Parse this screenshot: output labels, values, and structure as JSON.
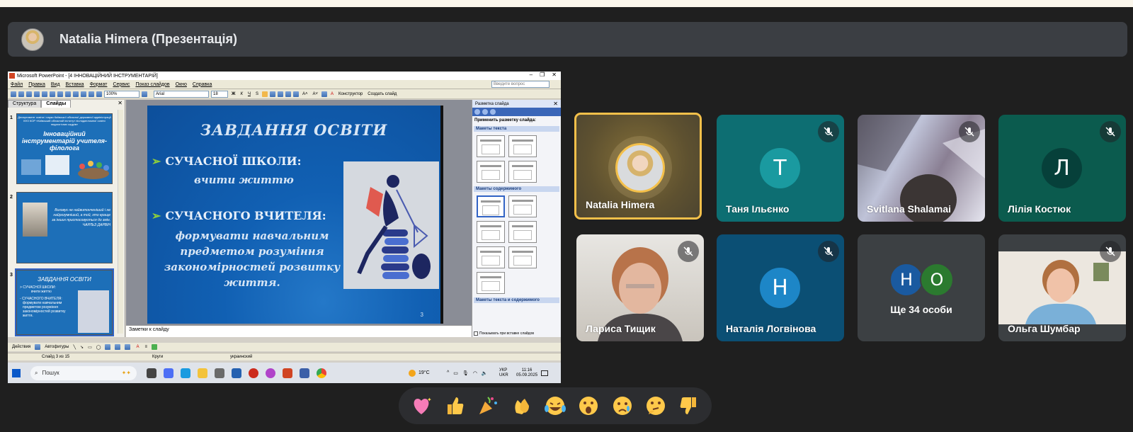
{
  "presenter": {
    "name": "Natalia Himera (Презентація)"
  },
  "ppt": {
    "window_title": "Microsoft PowerPoint - [4 ІННОВАЦІЙНИЙ ІНСТРУМЕНТАРІЙ]",
    "menu": [
      "Файл",
      "Правка",
      "Вид",
      "Вставка",
      "Формат",
      "Сервис",
      "Показ слайдов",
      "Окно",
      "Справка"
    ],
    "ask_placeholder": "Введите вопрос",
    "zoom": "100%",
    "font": "Arial",
    "font_size": "18",
    "designer_button": "Конструктор",
    "new_slide_button": "Создать слайд",
    "pane_tabs": [
      "Структура",
      "Слайды"
    ],
    "thumbnails": [
      {
        "num": "1",
        "head": "Департамент освіти і науки Київської обласної державної адміністрації КНЗ КОР «Київський обласний інститут післядипломної освіти педагогічних кадрів»",
        "title": "Інноваційний інструментарій учителя-філолога"
      },
      {
        "num": "2",
        "quote": "Виховує не найвитонченіший і не найрозумніший, а той, хто краще за інших пристосовується до змін.",
        "author": "ЧАРЛЬЗ ДАРВІН"
      },
      {
        "num": "3",
        "title": "ЗАВДАННЯ ОСВІТИ",
        "b1": "> СУЧАСНОЇ ШКОЛИ:",
        "s1": "вчити життю",
        "b2": "- СУЧАСНОГО ВЧИТЕЛЯ:",
        "s2": "формувати навчальним предметом розуміння закономірностей розвитку життя."
      }
    ],
    "slide": {
      "title": "ЗАВДАННЯ ОСВІТИ",
      "bullet1": "СУЧАСНОЇ ШКОЛИ:",
      "sub1": "вчити життю",
      "bullet2": "СУЧАСНОГО ВЧИТЕЛЯ:",
      "sub2": "формувати навчальним предметом розуміння закономірностей розвитку життя.",
      "number": "3"
    },
    "notes_placeholder": "Заметки к слайду",
    "taskpane": {
      "title": "Разметка слайда",
      "apply": "Применить разметку слайда:",
      "sec_text": "Макеты текста",
      "sec_content": "Макеты содержимого",
      "sec_text_content": "Макеты текста и содержимого",
      "show_on_insert": "Показывать при вставке слайдов"
    },
    "draw_bar": {
      "actions": "Действия",
      "autoshapes": "Автофигуры"
    },
    "status": {
      "slide": "Слайд 3 из 15",
      "design": "Круги",
      "lang": "украинский"
    },
    "taskbar": {
      "search": "Пошук",
      "weather": "19°C",
      "lang1": "УКР",
      "lang2": "UKR",
      "time": "11:16",
      "date": "05.09.2025"
    }
  },
  "participants": [
    {
      "name": "Natalia Himera",
      "type": "avatar",
      "speaking": true
    },
    {
      "name": "Таня Ільєнко",
      "letter": "Т",
      "bg": "#0d6e72",
      "circle": "#1a9aa0",
      "muted": true
    },
    {
      "name": "Svitlana Shalamai",
      "type": "video",
      "muted": true
    },
    {
      "name": "Лілія Костюк",
      "letter": "Л",
      "bg": "#0b5b4e",
      "circle": "#06403a",
      "muted": true
    },
    {
      "name": "Лариса Тищик",
      "type": "video",
      "muted": true
    },
    {
      "name": "Наталія Логвінова",
      "letter": "Н",
      "bg": "#0b4f74",
      "circle": "#1d86c7",
      "muted": true
    },
    {
      "name": "Ще 34 особи",
      "letters": [
        "Н",
        "О"
      ],
      "bg": "#3c4043"
    },
    {
      "name": "Ольга Шумбар",
      "type": "video",
      "muted": true
    }
  ],
  "reactions": [
    {
      "name": "sparkling-heart-icon",
      "glyph": "💖"
    },
    {
      "name": "thumbs-up-icon",
      "glyph": "👍"
    },
    {
      "name": "party-popper-icon",
      "glyph": "🎉"
    },
    {
      "name": "clapping-hands-icon",
      "glyph": "👏"
    },
    {
      "name": "tears-of-joy-icon",
      "glyph": "😂"
    },
    {
      "name": "surprised-face-icon",
      "glyph": "😮"
    },
    {
      "name": "crying-face-icon",
      "glyph": "😢"
    },
    {
      "name": "thinking-face-icon",
      "glyph": "🤔"
    },
    {
      "name": "thumbs-down-icon",
      "glyph": "👎"
    }
  ],
  "colors": {
    "speaking_border": "#f4c04a",
    "tile_bg": "#3c4043",
    "page_bg": "#1f1f1f"
  }
}
